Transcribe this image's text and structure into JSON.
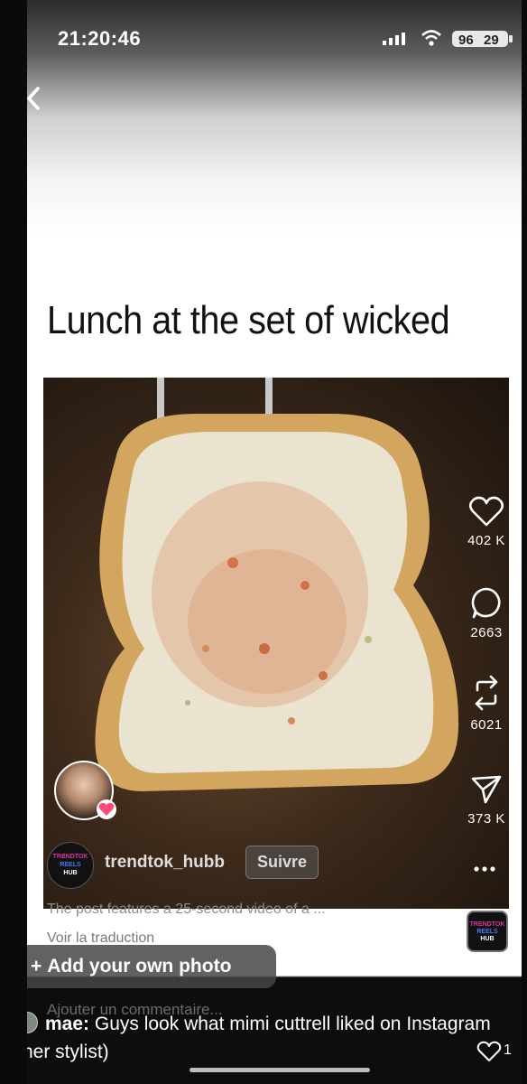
{
  "status_bar": {
    "time": "21:20:46",
    "battery": "29",
    "signal_badge": "96"
  },
  "post": {
    "headline": "Lunch at the set of wicked",
    "actions": {
      "likes": "402 K",
      "comments": "2663",
      "reposts": "6021",
      "shares": "373 K"
    },
    "account": {
      "logo_lines": [
        "TRENDTOK",
        "REELS",
        "HUB"
      ],
      "username": "trendtok_hubb",
      "follow_label": "Suivre"
    },
    "description": "The post features a 25-second video of a ...",
    "translate_label": "Voir la traduction"
  },
  "add_photo": {
    "plus": "+",
    "label": "Add your own photo"
  },
  "comment_input": {
    "placeholder": "Ajouter un commentaire..."
  },
  "caption": {
    "author": "mae",
    "text": "Guys look what mimi cuttrell liked on Instagram (her stylist)",
    "likes": "1"
  },
  "colors": {
    "like_badge": "#ff4a7d",
    "logo_accent": "#3d7bff",
    "logo_pink": "#e0339b"
  }
}
